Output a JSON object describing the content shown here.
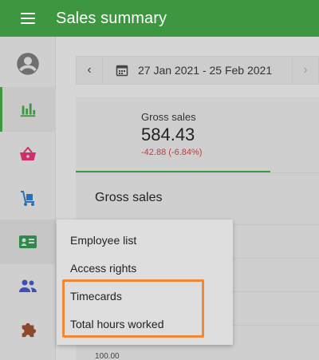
{
  "appbar": {
    "title": "Sales summary"
  },
  "sidebar": {
    "items": [
      {
        "name": "account",
        "icon": "account-circle-icon"
      },
      {
        "name": "analytics",
        "icon": "bar-chart-icon",
        "active": true
      },
      {
        "name": "items",
        "icon": "basket-icon"
      },
      {
        "name": "inventory",
        "icon": "dolly-icon"
      },
      {
        "name": "employees",
        "icon": "badge-icon",
        "highlight": true
      },
      {
        "name": "customers",
        "icon": "people-icon"
      },
      {
        "name": "integrations",
        "icon": "puzzle-icon"
      }
    ]
  },
  "datebar": {
    "range": "27 Jan 2021 - 25 Feb 2021",
    "prev": "‹",
    "next": "›"
  },
  "metric": {
    "label": "Gross sales",
    "value": "584.43",
    "delta": "-42.88 (-6.84%)"
  },
  "chart": {
    "title": "Gross sales",
    "visible_tick": "100.00"
  },
  "dropdown": {
    "items": [
      "Employee list",
      "Access rights",
      "Timecards",
      "Total hours worked"
    ]
  },
  "colors": {
    "primary": "#3d9740",
    "negative": "#c43b3b",
    "highlight": "#f0883a"
  }
}
